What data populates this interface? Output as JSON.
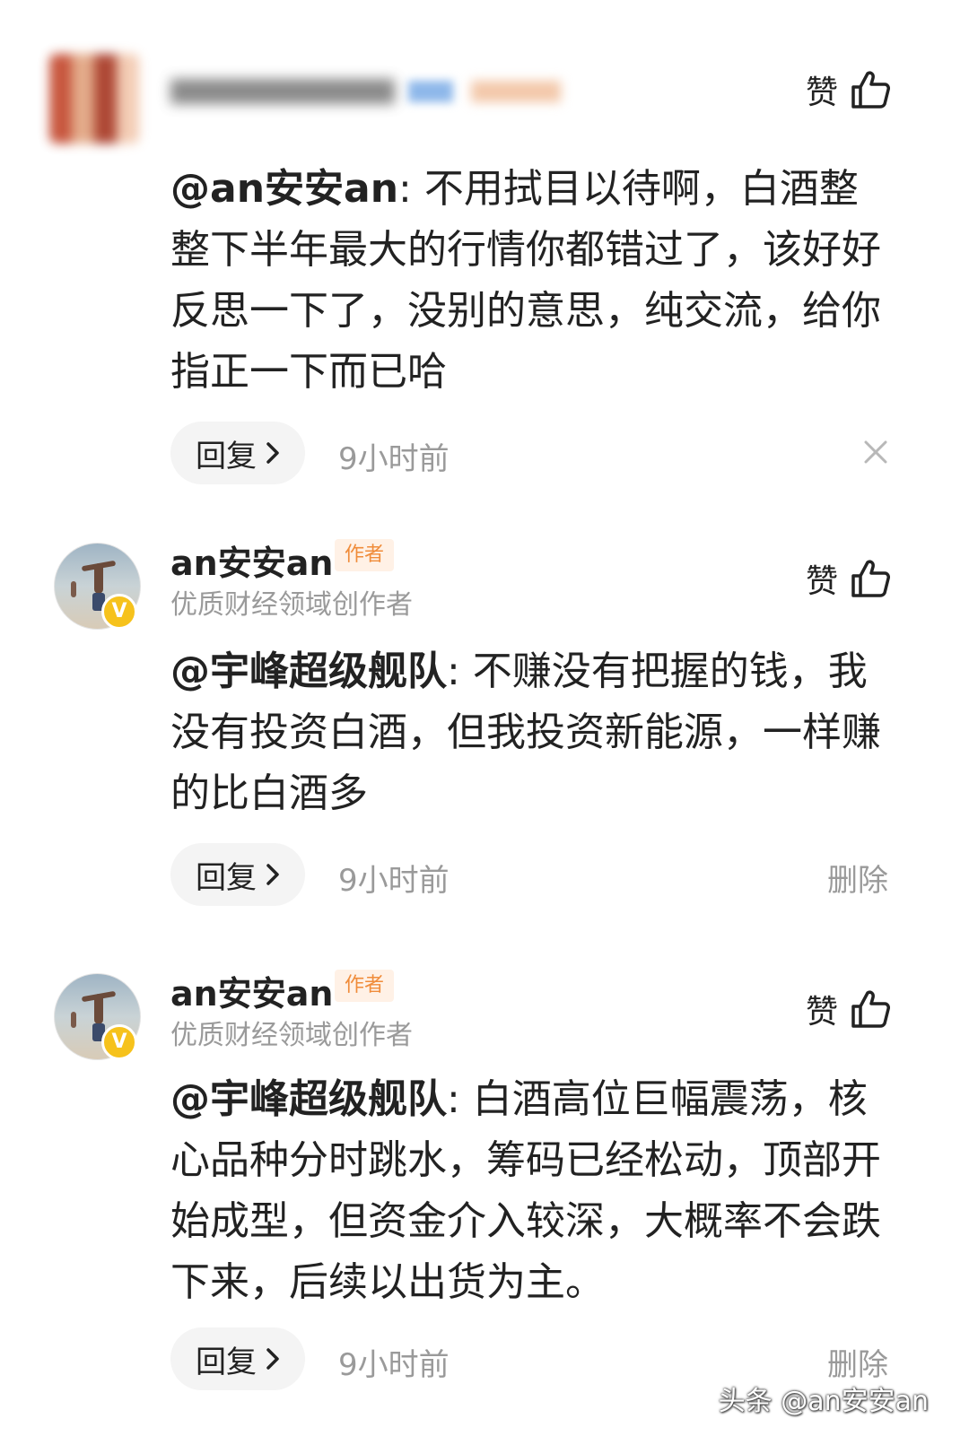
{
  "comments": [
    {
      "like_label": "赞",
      "mention": "@an安安an",
      "body": ": 不用拭目以待啊，白酒整整下半年最大的行情你都错过了，该好好反思一下了，没别的意思，纯交流，给你指正一下而已哈",
      "reply_label": "回复",
      "time": "9小时前"
    },
    {
      "name": "an安安an",
      "author_tag": "作者",
      "subtitle": "优质财经领域创作者",
      "badge": "V",
      "like_label": "赞",
      "mention": "@宇峰超级舰队",
      "body": ": 不赚没有把握的钱，我没有投资白酒，但我投资新能源，一样赚的比白酒多",
      "reply_label": "回复",
      "time": "9小时前",
      "delete_label": "删除"
    },
    {
      "name": "an安安an",
      "author_tag": "作者",
      "subtitle": "优质财经领域创作者",
      "badge": "V",
      "like_label": "赞",
      "mention": "@宇峰超级舰队",
      "body": ": 白酒高位巨幅震荡，核心品种分时跳水，筹码已经松动，顶部开始成型，但资金介入较深，大概率不会跌下来，后续以出货为主。",
      "reply_label": "回复",
      "time": "9小时前",
      "delete_label": "删除"
    }
  ],
  "watermark": "头条 @an安安an",
  "icons": {
    "like": "thumbs-up-icon",
    "chevron": "chevron-right-icon",
    "close": "close-icon"
  }
}
